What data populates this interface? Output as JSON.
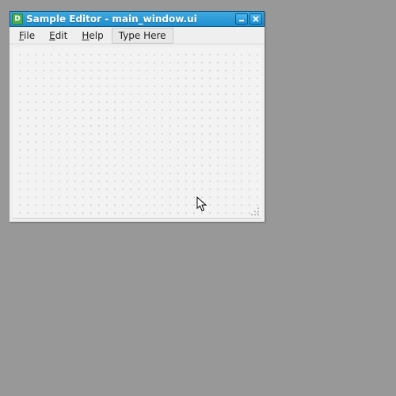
{
  "window": {
    "title": "Sample Editor - main_window.ui"
  },
  "menubar": {
    "items": [
      {
        "label": "File",
        "accel_index": 0
      },
      {
        "label": "Edit",
        "accel_index": 0
      },
      {
        "label": "Help",
        "accel_index": 0
      }
    ],
    "type_here_label": "Type Here"
  }
}
